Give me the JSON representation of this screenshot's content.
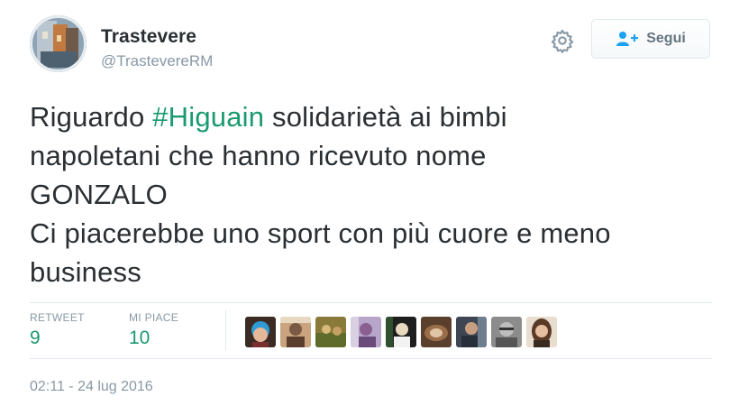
{
  "user": {
    "display_name": "Trastevere",
    "screen_name": "@TrastevereRM",
    "avatar_icon": "profile-photo"
  },
  "actions": {
    "settings_icon": "gear-icon",
    "follow_icon": "user-plus-icon",
    "follow_label": "Segui"
  },
  "tweet": {
    "line1_pre": "Riguardo ",
    "hashtag": "#Higuain",
    "line1_post": " solidarietà ai bimbi",
    "line2": "napoletani che hanno ricevuto nome",
    "line3": "GONZALO",
    "line4": "Ci piacerebbe uno sport con più cuore e meno",
    "line5": "business"
  },
  "stats": {
    "retweets_label": "RETWEET",
    "retweets_value": "9",
    "likes_label": "MI PIACE",
    "likes_value": "10"
  },
  "timestamp": "02:11 - 24 lug 2016",
  "colors": {
    "link": "#1a9a6f",
    "muted": "#8899a6",
    "text": "#292f33"
  }
}
